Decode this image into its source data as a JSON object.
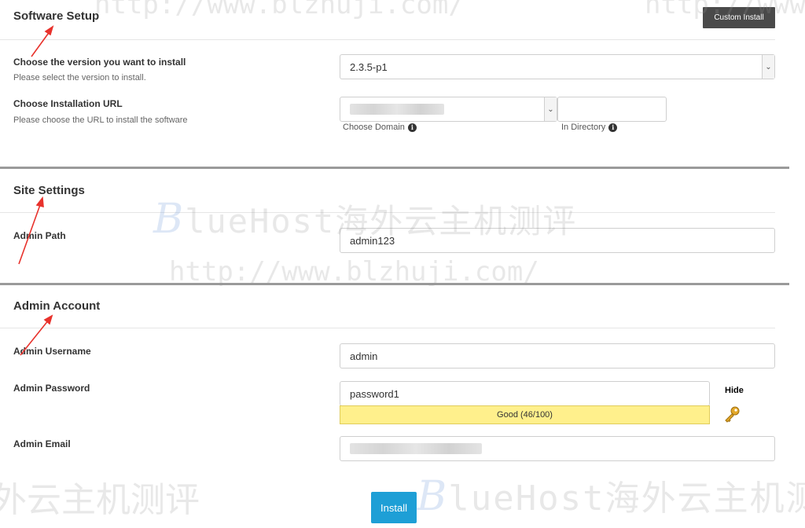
{
  "watermarks": {
    "url": "http://www.blzhuji.com/",
    "brand": "lueHost海外云主机测评",
    "brand_initial": "B",
    "top_right": "http://www",
    "bottom_left": "外云主机测评",
    "bottom_right": "lueHost海外云主机测"
  },
  "software_setup": {
    "title": "Software Setup",
    "custom_install_label": "Custom Install",
    "version": {
      "label": "Choose the version you want to install",
      "hint": "Please select the version to install.",
      "selected": "2.3.5-p1"
    },
    "install_url": {
      "label": "Choose Installation URL",
      "hint": "Please choose the URL to install the software",
      "domain_caption": "Choose Domain",
      "directory_caption": "In Directory",
      "directory_value": ""
    }
  },
  "site_settings": {
    "title": "Site Settings",
    "admin_path": {
      "label": "Admin Path",
      "value": "admin123"
    }
  },
  "admin_account": {
    "title": "Admin Account",
    "username": {
      "label": "Admin Username",
      "value": "admin"
    },
    "password": {
      "label": "Admin Password",
      "value": "password1",
      "hide_label": "Hide",
      "strength": "Good (46/100)"
    },
    "email": {
      "label": "Admin Email"
    }
  },
  "install_label": "Install",
  "icons": {
    "info": "info-icon",
    "key": "key-icon",
    "dropdown": "chevron-down-icon"
  },
  "colors": {
    "install_button": "#1e9fd6",
    "custom_install_button": "#4a4a4a",
    "strength_good": "#fff08c",
    "annotation_arrow": "#e8322c"
  }
}
